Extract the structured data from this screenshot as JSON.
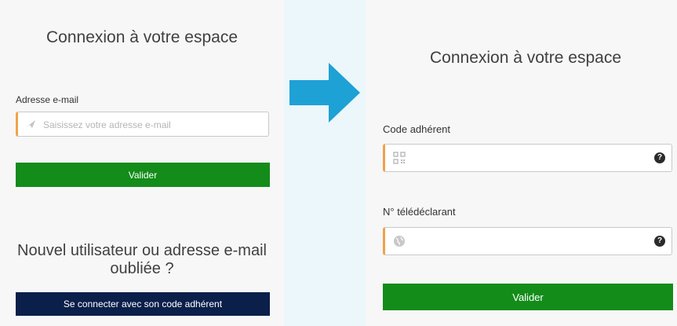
{
  "left_panel": {
    "title": "Connexion à votre espace",
    "email_label": "Adresse e-mail",
    "email_placeholder": "Saisissez votre adresse e-mail",
    "email_value": "",
    "submit_label": "Valider",
    "new_user_heading": "Nouvel utilisateur ou adresse e-mail oubliée ?",
    "code_login_label": "Se connecter avec son code adhérent"
  },
  "right_panel": {
    "title": "Connexion à votre espace",
    "code_label": "Code adhérent",
    "code_value": "",
    "teledeclarant_label": "N° télédéclarant",
    "teledeclarant_value": "",
    "help_symbol": "?",
    "submit_label": "Valider"
  },
  "icons": {
    "email_field": "send-icon",
    "code_field": "qr-code-icon",
    "teledeclarant_field": "globe-icon",
    "help": "help-icon",
    "transition": "arrow-right-icon"
  },
  "colors": {
    "background": "#ebf7fa",
    "panel": "#f7f7f7",
    "primary_button": "#138c1a",
    "secondary_button": "#0b1f4b",
    "field_accent": "#f0a24b",
    "arrow": "#1ea1d5"
  }
}
